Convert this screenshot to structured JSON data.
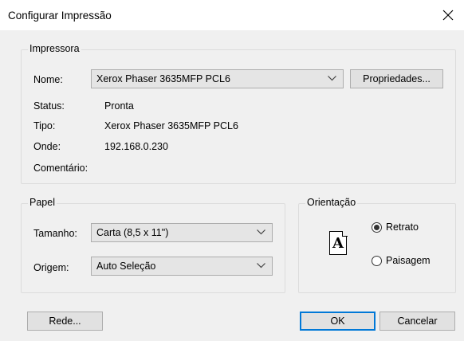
{
  "window": {
    "title": "Configurar Impressão"
  },
  "printer": {
    "group_label": "Impressora",
    "name_label": "Nome:",
    "name_value": "Xerox Phaser 3635MFP PCL6",
    "properties_button": "Propriedades...",
    "status_label": "Status:",
    "status_value": "Pronta",
    "type_label": "Tipo:",
    "type_value": "Xerox Phaser 3635MFP PCL6",
    "where_label": "Onde:",
    "where_value": "192.168.0.230",
    "comment_label": "Comentário:"
  },
  "paper": {
    "group_label": "Papel",
    "size_label": "Tamanho:",
    "size_value": "Carta (8,5 x 11\")",
    "source_label": "Origem:",
    "source_value": "Auto Seleção"
  },
  "orientation": {
    "group_label": "Orientação",
    "icon_letter": "A",
    "portrait_label": "Retrato",
    "landscape_label": "Paisagem",
    "selected": "Retrato"
  },
  "buttons": {
    "network": "Rede...",
    "ok": "OK",
    "cancel": "Cancelar"
  },
  "icons": {
    "close": "close-icon",
    "dropdown": "chevron-down-icon"
  }
}
